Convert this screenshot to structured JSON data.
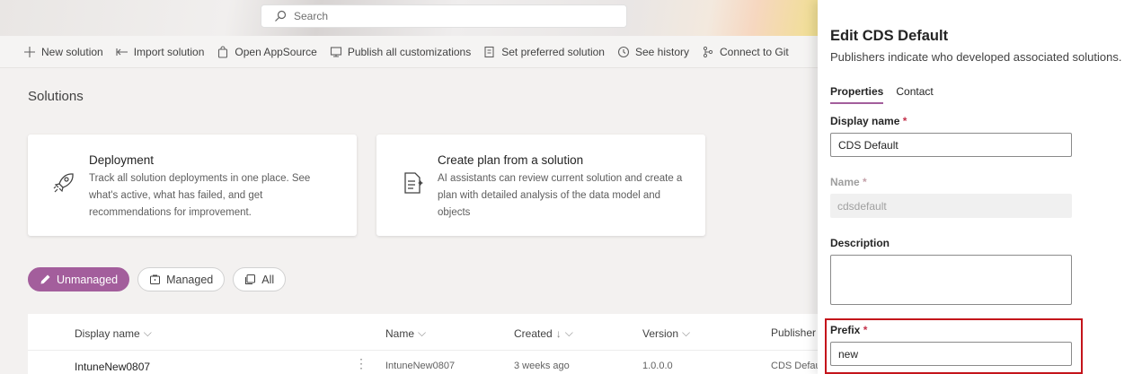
{
  "search": {
    "placeholder": "Search"
  },
  "commands": [
    {
      "label": "New solution",
      "icon": "plus-icon"
    },
    {
      "label": "Import solution",
      "icon": "import-arrow-icon"
    },
    {
      "label": "Open AppSource",
      "icon": "shopping-bag-icon"
    },
    {
      "label": "Publish all customizations",
      "icon": "publish-icon"
    },
    {
      "label": "Set preferred solution",
      "icon": "preferred-solution-icon"
    },
    {
      "label": "See history",
      "icon": "history-icon"
    },
    {
      "label": "Connect to Git",
      "icon": "git-branch-icon"
    }
  ],
  "main": {
    "title": "Solutions"
  },
  "cards": [
    {
      "title": "Deployment",
      "description": "Track all solution deployments in one place. See what's active, what has failed, and get recommendations for improvement.",
      "icon": "rocket-icon"
    },
    {
      "title": "Create plan from a solution",
      "description": "AI assistants can review current solution and create a plan with detailed analysis of the data model and objects",
      "icon": "document-sparkle-icon"
    }
  ],
  "filters": [
    {
      "label": "Unmanaged",
      "icon": "pencil-icon",
      "active": true
    },
    {
      "label": "Managed",
      "icon": "package-icon",
      "active": false
    },
    {
      "label": "All",
      "icon": "stack-icon",
      "active": false
    }
  ],
  "table": {
    "columns": [
      "Display name",
      "Name",
      "Created",
      "Version",
      "Publisher"
    ],
    "rows": [
      {
        "display_name": "IntuneNew0807",
        "name": "IntuneNew0807",
        "created": "3 weeks ago",
        "version": "1.0.0.0",
        "publisher": "CDS Default"
      }
    ]
  },
  "panel": {
    "title": "Edit CDS Default",
    "subtitle": "Publishers indicate who developed associated solutions.",
    "tabs": [
      "Properties",
      "Contact"
    ],
    "fields": {
      "display_name": {
        "label": "Display name",
        "value": "CDS Default"
      },
      "name": {
        "label": "Name",
        "value": "cdsdefault"
      },
      "description": {
        "label": "Description",
        "value": ""
      },
      "prefix": {
        "label": "Prefix",
        "value": "new"
      }
    },
    "required_mark": "*"
  },
  "colors": {
    "accent": "#a35e9c",
    "highlight": "#c4141b"
  }
}
